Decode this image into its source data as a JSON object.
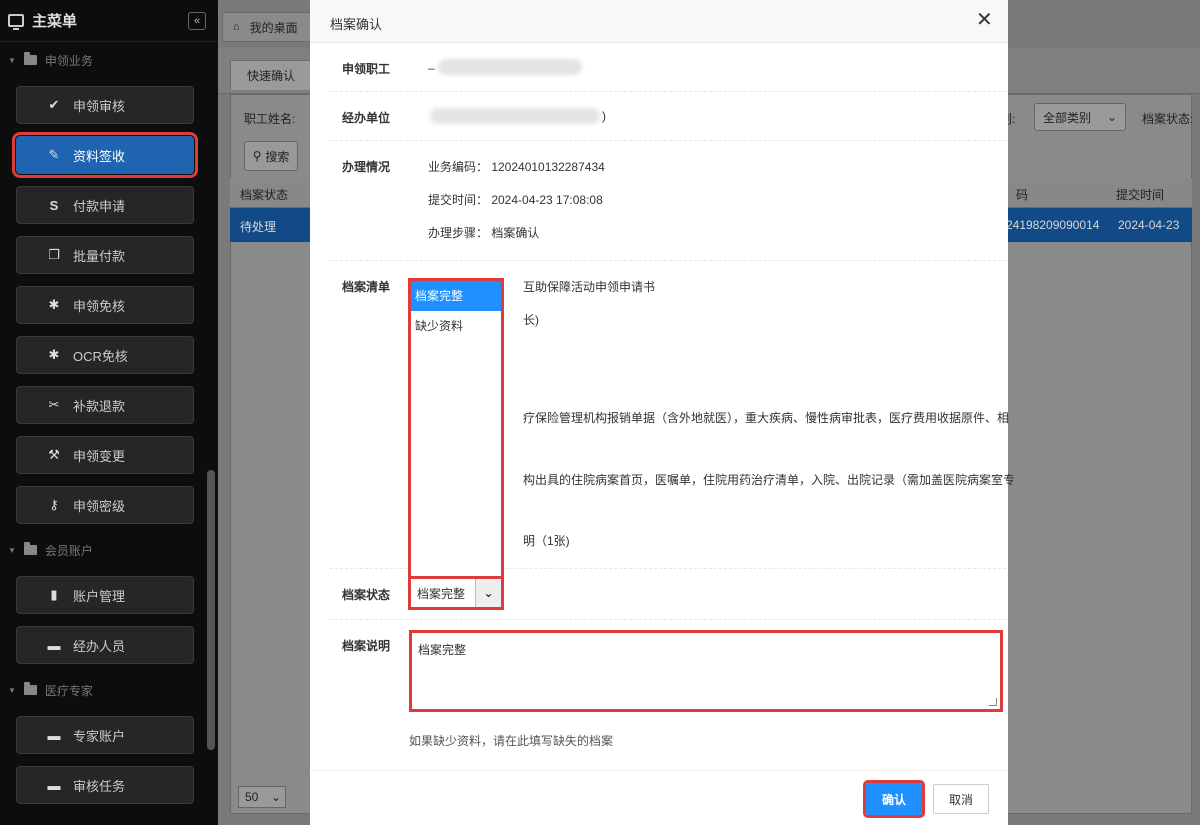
{
  "sidebar": {
    "title": "主菜单",
    "groups": [
      {
        "label": "申领业务"
      },
      {
        "label": "会员账户"
      },
      {
        "label": "医疗专家"
      }
    ],
    "items": [
      {
        "label": "申领审核",
        "icon": "check-icon"
      },
      {
        "label": "资料签收",
        "icon": "pencil-icon"
      },
      {
        "label": "付款申请",
        "icon": "dollar-icon"
      },
      {
        "label": "批量付款",
        "icon": "copy-icon"
      },
      {
        "label": "申领免核",
        "icon": "gear-icon"
      },
      {
        "label": "OCR免核",
        "icon": "gear-icon"
      },
      {
        "label": "补款退款",
        "icon": "tools-icon"
      },
      {
        "label": "申领变更",
        "icon": "wrench-icon"
      },
      {
        "label": "申领密级",
        "icon": "key-icon"
      },
      {
        "label": "账户管理",
        "icon": "card-icon"
      },
      {
        "label": "经办人员",
        "icon": "archive-icon"
      },
      {
        "label": "专家账户",
        "icon": "archive-icon"
      },
      {
        "label": "审核任务",
        "icon": "archive-icon"
      }
    ]
  },
  "background": {
    "desk_tab": "我的桌面",
    "quick_tab": "快速确认",
    "employee_label": "职工姓名:",
    "search_button": "搜索",
    "category_suffix": "别:",
    "category_value": "全部类别",
    "status_label": "档案状态:",
    "col_status": "档案状态",
    "col_code": "码",
    "col_time": "提交时间",
    "row_status": "待处理",
    "row_code": "24198209090014",
    "row_time": "2024-04-23",
    "page_size": "50"
  },
  "modal": {
    "title": "档案确认",
    "applicant_label": "申领职工",
    "applicant_value": "_",
    "unit_label": "经办单位",
    "unit_value": ")",
    "handling_label": "办理情况",
    "business_code": "业务编码： 12024010132287434",
    "submit_time": "提交时间： 2024-04-23 17:08:08",
    "step": "办理步骤： 档案确认",
    "checklist_label": "档案清单",
    "checklist_lines": [
      "互助保障活动申领申请书",
      "长)",
      "疗保险管理机构报销单据（含外地就医），重大疾病、慢性病审批表，医疗费用收据原件、相",
      "构出具的住院病案首页，医嘱单，住院用药治疗清单，入院、出院记录（需加盖医院病案室专",
      "明（1张)"
    ],
    "status_label": "档案状态",
    "status_options": [
      "档案完整",
      "缺少资料"
    ],
    "status_selected": "档案完整",
    "desc_label": "档案说明",
    "desc_value": "档案完整",
    "hint": "如果缺少资料，请在此填写缺失的档案",
    "confirm_button": "确认",
    "cancel_button": "取消"
  }
}
